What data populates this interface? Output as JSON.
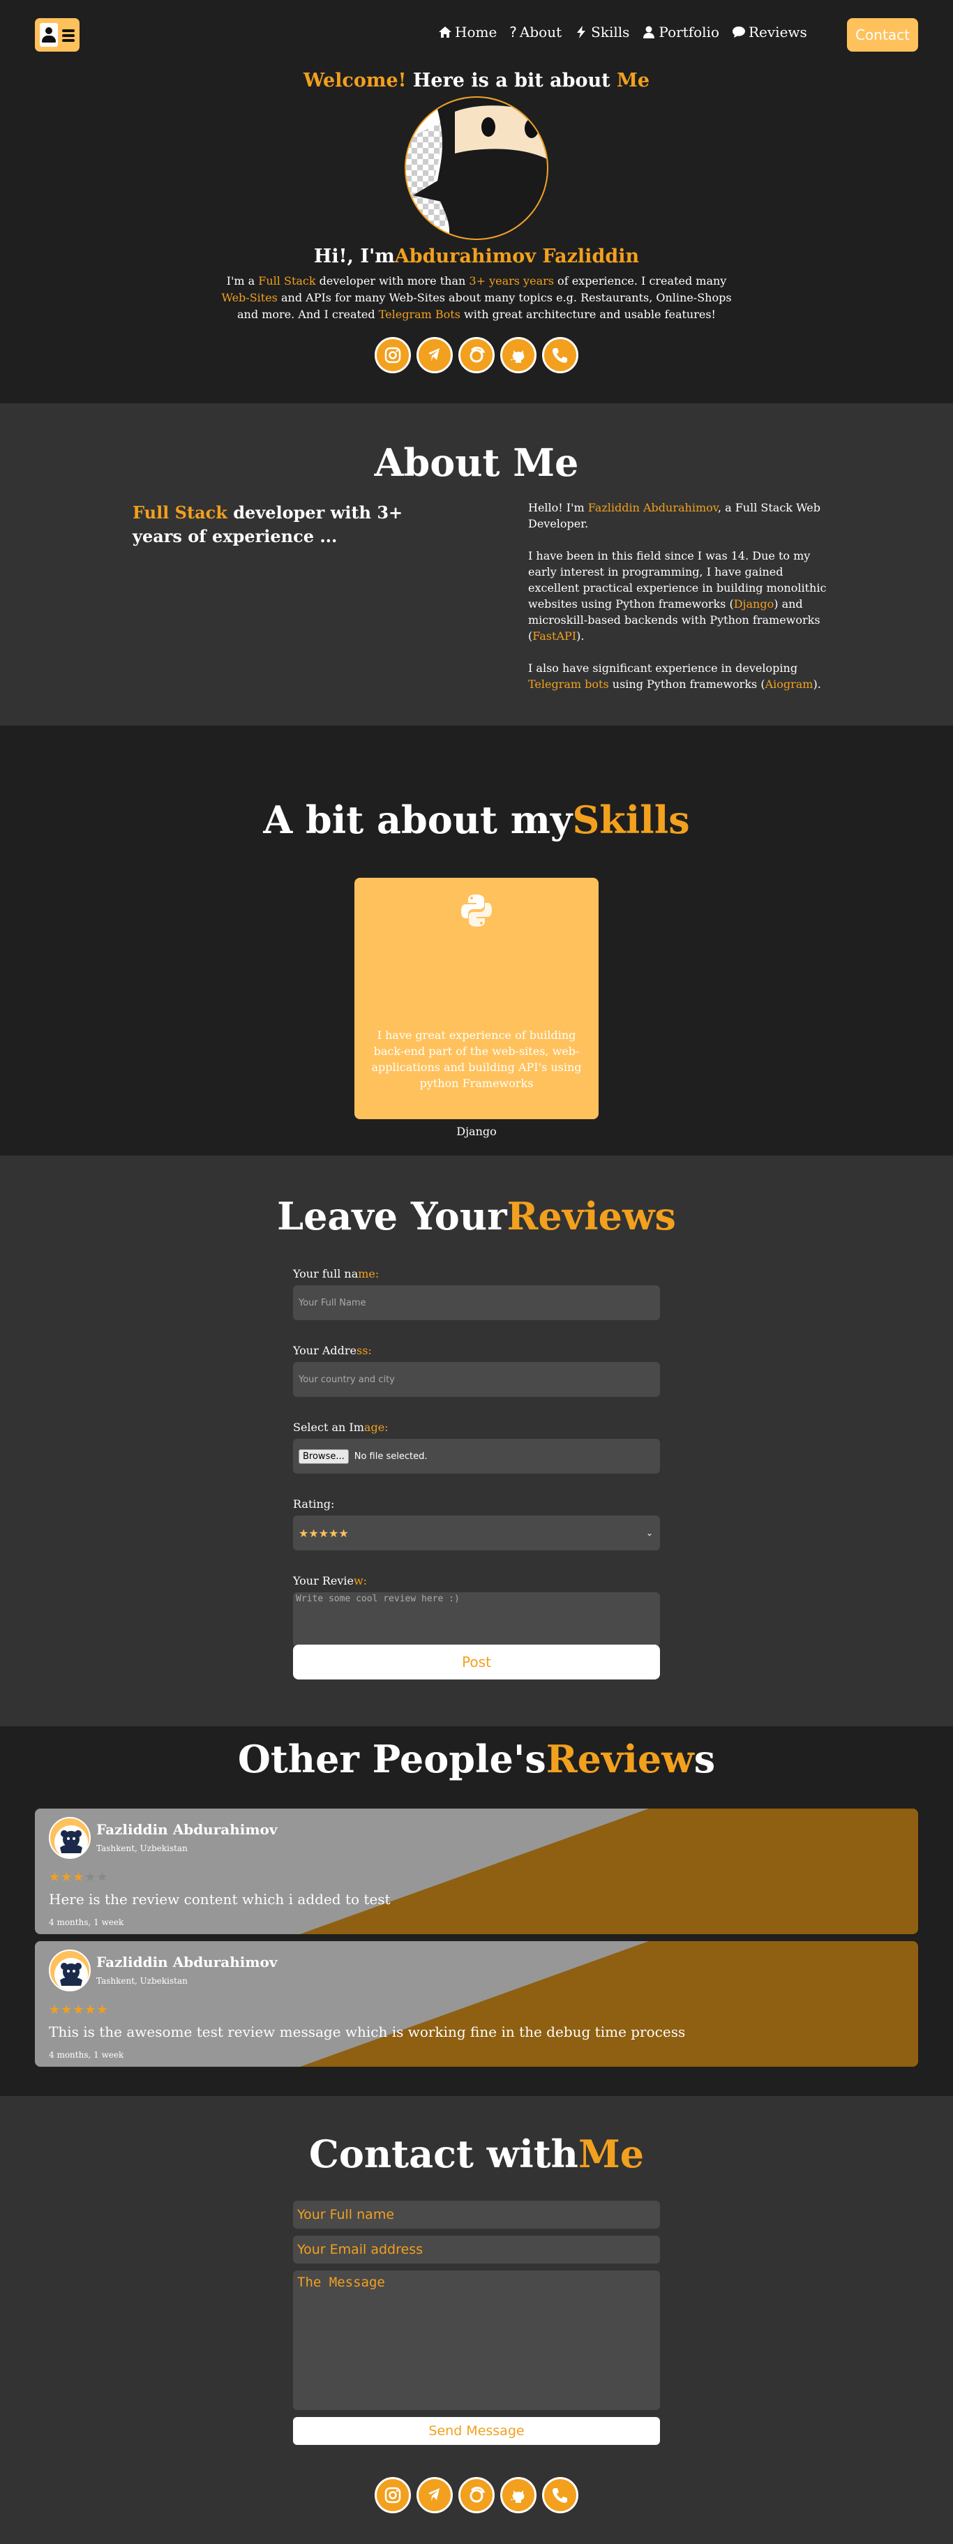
{
  "nav": {
    "home": "Home",
    "about": "About",
    "skills": "Skills",
    "portfolio": "Portfolio",
    "reviews": "Reviews",
    "contact": "Contact"
  },
  "hero": {
    "welcome": "Welcome!",
    "title_mid": " Here is a bit about ",
    "title_me": "Me",
    "greeting": "Hi!, I'm",
    "name": "Abdurahimov Fazliddin",
    "desc_1": "I'm a ",
    "desc_fullstack": "Full Stack",
    "desc_2": " developer with more than ",
    "desc_years": "3+ years years",
    "desc_3": " of experience. I created many ",
    "desc_websites": "Web-Sites",
    "desc_4": " and APIs for many Web-Sites about many topics e.g. Restaurants, Online-Shops and more. And I created ",
    "desc_bots": "Telegram Bots",
    "desc_5": " with great architecture and usable features!"
  },
  "socials": [
    "instagram-icon",
    "telegram-icon",
    "codewars-icon",
    "github-icon",
    "phone-icon"
  ],
  "about": {
    "title": "About Me",
    "left_hl": "Full Stack",
    "left_rest": " developer with 3+ years of experience ...",
    "p1_a": "Hello! I'm ",
    "p1_name": "Fazliddin Abdurahimov",
    "p1_b": ", a Full Stack Web Developer.",
    "p2_a": "I have been in this field since I was 14. Due to my early interest in programming, I have gained excellent practical experience in building monolithic websites using Python frameworks (",
    "p2_django": "Django",
    "p2_b": ") and microskill-based backends with Python frameworks (",
    "p2_fastapi": "FastAPI",
    "p2_c": ").",
    "p3_a": "I also have significant experience in developing ",
    "p3_bots": "Telegram bots",
    "p3_b": " using Python frameworks (",
    "p3_aiogram": "Aiogram",
    "p3_c": ")."
  },
  "skills": {
    "title_a": "A bit about my",
    "title_b": "Skills",
    "card_desc": "I have great experience of building back-end part of the web-sites, web-applications and building API's using python Frameworks",
    "card_name": "Django"
  },
  "review_form": {
    "title_a": "Leave Your",
    "title_b": "Reviews",
    "name_label_a": "Your full na",
    "name_label_b": "me:",
    "name_placeholder": "Your Full Name",
    "address_label_a": "Your Addre",
    "address_label_b": "ss:",
    "address_placeholder": "Your country and city",
    "image_label_a": "Select an Im",
    "image_label_b": "age:",
    "browse": "Browse...",
    "no_file": "No file selected.",
    "rating_label": "Rating:",
    "rating_value": "★★★★★",
    "review_label_a": "Your Revie",
    "review_label_b": "w:",
    "review_placeholder": "Write some cool review here :)",
    "post": "Post"
  },
  "reviews": {
    "title_a": "Other People's",
    "title_b": "Review",
    "title_c": "s",
    "colors": {
      "card_left": "#979797",
      "card_right": "#8f6011"
    },
    "items": [
      {
        "name": "Fazliddin Abdurahimov",
        "location": "Tashkent, Uzbekistan",
        "stars_on": "★★★",
        "stars_off": "★★",
        "rating": 3,
        "text": "Here is the review content which i added to test",
        "time": "4 months, 1 week"
      },
      {
        "name": "Fazliddin Abdurahimov",
        "location": "Tashkent, Uzbekistan",
        "stars_on": "★★★★★",
        "stars_off": "",
        "rating": 5,
        "text": "This is the awesome test review message which is working fine in the debug time process",
        "time": "4 months, 1 week"
      }
    ]
  },
  "contact": {
    "title_a": "Contact with",
    "title_b": "Me",
    "name_placeholder": "Your Full name",
    "email_placeholder": "Your Email address",
    "message_placeholder": "The Message",
    "send": "Send Message"
  },
  "colors": {
    "accent": "#f2a01e",
    "accent_light": "#ffc15c",
    "dark_bg": "#1f1f1f",
    "mid_bg": "#333333"
  }
}
